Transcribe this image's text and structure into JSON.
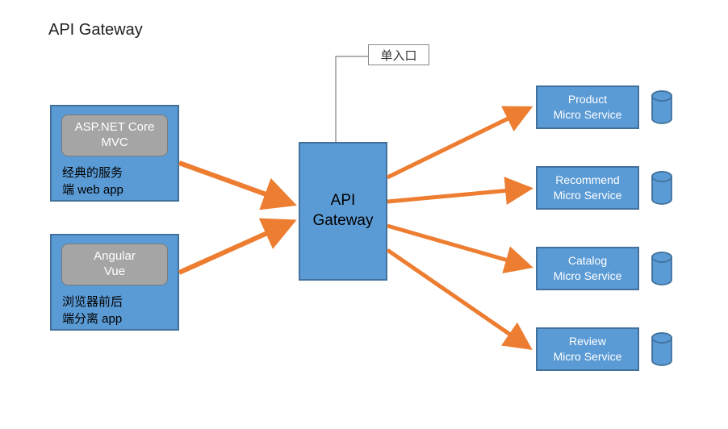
{
  "title": "API Gateway",
  "callout": {
    "label": "单入口"
  },
  "clients": [
    {
      "tech": "ASP.NET Core\nMVC",
      "desc": "经典的服务\n端 web app"
    },
    {
      "tech": "Angular\nVue",
      "desc": "浏览器前后\n端分离 app"
    }
  ],
  "gateway": {
    "label": "API\nGateway"
  },
  "services": [
    {
      "label": "Product\nMicro Service"
    },
    {
      "label": "Recommend\nMicro Service"
    },
    {
      "label": "Catalog\nMicro Service"
    },
    {
      "label": "Review\nMicro Service"
    }
  ],
  "colors": {
    "box_fill": "#5b9bd5",
    "box_border": "#41719c",
    "pill_fill": "#a5a5a5",
    "pill_border": "#7b7b7b",
    "arrow": "#ed7d31",
    "callout_line": "#808080"
  }
}
